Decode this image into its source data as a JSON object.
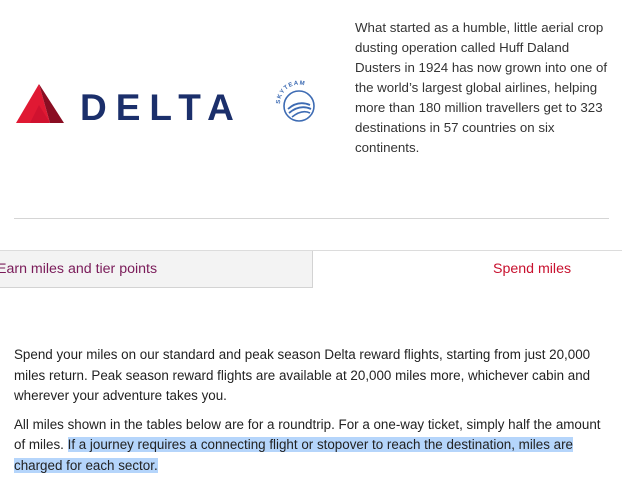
{
  "brand": {
    "logo_text": "DELTA",
    "alliance_text": "SKYTEAM",
    "colors": {
      "delta_navy": "#1b2f6b",
      "delta_red": "#c8102e",
      "delta_dark_red": "#7d0c1f",
      "skyteam_blue": "#3d6bb3"
    }
  },
  "intro": {
    "text": "What started as a humble, little aerial crop dusting operation called Huff Daland Dusters in 1924 has now grown into one of the world’s largest global airlines, helping more than 180 million travellers get to 323 destinations in 57 countries on six continents."
  },
  "tabs": [
    {
      "label": "Earn miles and tier points",
      "active": false
    },
    {
      "label": "Spend miles",
      "active": true
    }
  ],
  "content": {
    "paragraph1": "Spend your miles on our standard and peak season Delta reward flights, starting from just 20,000 miles return. Peak season reward flights are available at 20,000 miles more, whichever cabin and wherever your adventure takes you.",
    "paragraph2_plain": "All miles shown in the tables below are for a roundtrip. For a one-way ticket, simply half the amount of miles.",
    "paragraph2_selected": "If a journey requires a connecting flight or stopover to reach the destination, miles are charged for each sector.",
    "selection_color": "#b5d5fb"
  }
}
